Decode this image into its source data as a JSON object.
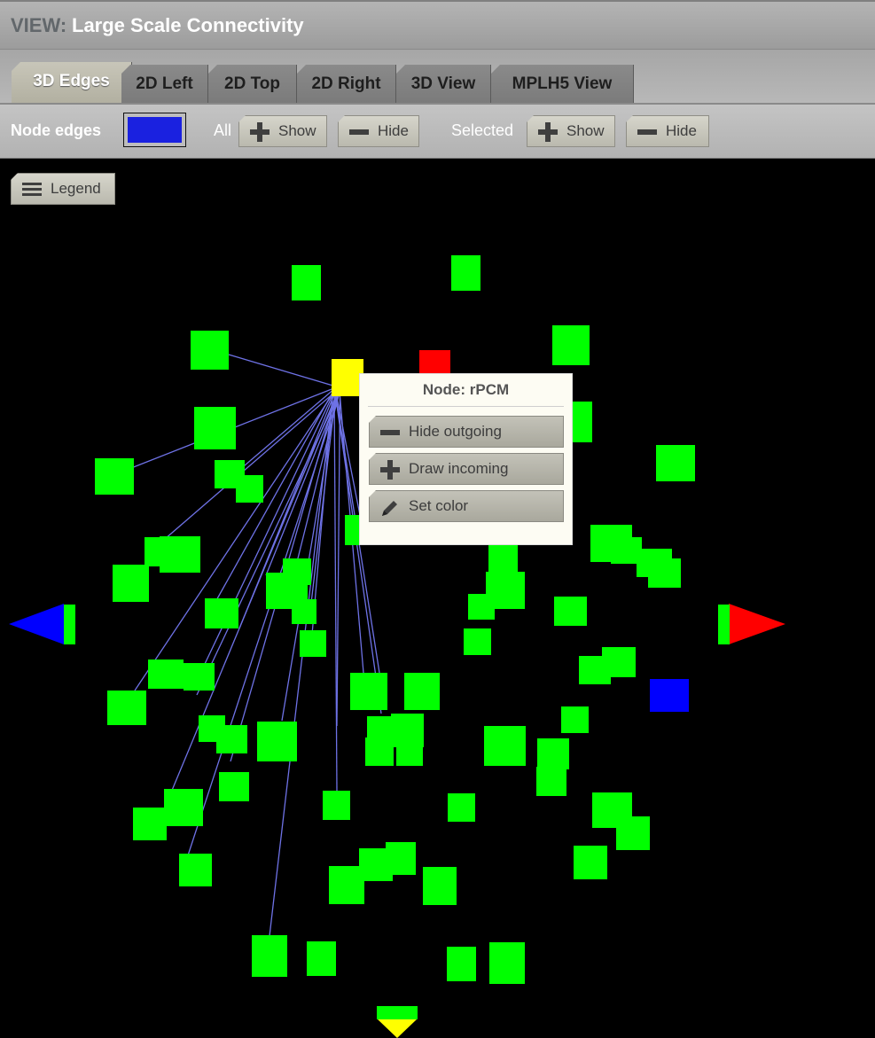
{
  "header": {
    "view_prefix": "VIEW:",
    "title": "Large Scale Connectivity"
  },
  "tabs": [
    {
      "label": "3D Edges",
      "active": true
    },
    {
      "label": "2D Left",
      "active": false
    },
    {
      "label": "2D Top",
      "active": false
    },
    {
      "label": "2D Right",
      "active": false
    },
    {
      "label": "3D View",
      "active": false
    },
    {
      "label": "MPLH5 View",
      "active": false
    }
  ],
  "toolbar": {
    "node_edges_label": "Node edges",
    "node_edges_color": "#1a21e0",
    "all_label": "All",
    "selected_label": "Selected",
    "show_label": "Show",
    "hide_label": "Hide"
  },
  "legend": {
    "label": "Legend"
  },
  "popup": {
    "title": "Node: rPCM",
    "actions": [
      "Hide outgoing",
      "Draw incoming",
      "Set color"
    ]
  },
  "colors": {
    "node": "#00ff00",
    "selected_node": "#ffff00",
    "edge": "#6f72ff",
    "axis_left": "#0000ff",
    "axis_right": "#ff0000",
    "axis_bottom": "#ffff00"
  },
  "icons": {
    "legend": "hamburger-icon",
    "show": "plus-icon",
    "hide": "minus-icon",
    "hide_outgoing": "minus-icon",
    "draw_incoming": "plus-icon",
    "set_color": "pencil-icon"
  }
}
